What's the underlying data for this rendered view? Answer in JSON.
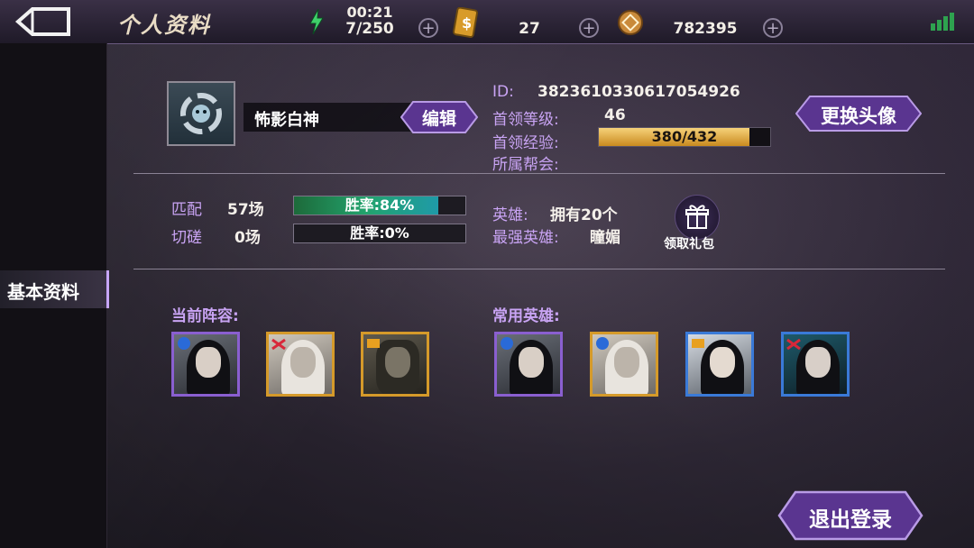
{
  "header": {
    "title": "个人资料",
    "energy": {
      "timer": "00:21",
      "count": "7/250"
    },
    "tickets": "27",
    "coins": "782395"
  },
  "sidebar": {
    "tab_basic": "基本资料"
  },
  "profile": {
    "name": "怖影白神",
    "edit_label": "编辑",
    "change_avatar_label": "更换头像",
    "id_label": "ID:",
    "id_value": "3823610330617054926",
    "level_label": "首领等级:",
    "level_value": "46",
    "exp_label": "首领经验:",
    "exp_text": "380/432",
    "exp_progress": 0.88,
    "guild_label": "所属帮会:",
    "guild_value": ""
  },
  "stats": {
    "match_label": "匹配",
    "match_count": "57场",
    "match_winrate": "胜率:84%",
    "match_winrate_value": 0.84,
    "spar_label": "切磋",
    "spar_count": "0场",
    "spar_winrate": "胜率:0%",
    "spar_winrate_value": 0,
    "heroes_label": "英雄:",
    "heroes_value": "拥有20个",
    "strongest_label": "最强英雄:",
    "strongest_value": "瞳媚",
    "gift_label": "领取礼包"
  },
  "lineup": {
    "current_label": "当前阵容:",
    "common_label": "常用英雄:"
  },
  "logout_label": "退出登录",
  "colors": {
    "accent": "#c9a4f4",
    "gold": "#d9a441",
    "purple_button": "#6a3f9e"
  }
}
